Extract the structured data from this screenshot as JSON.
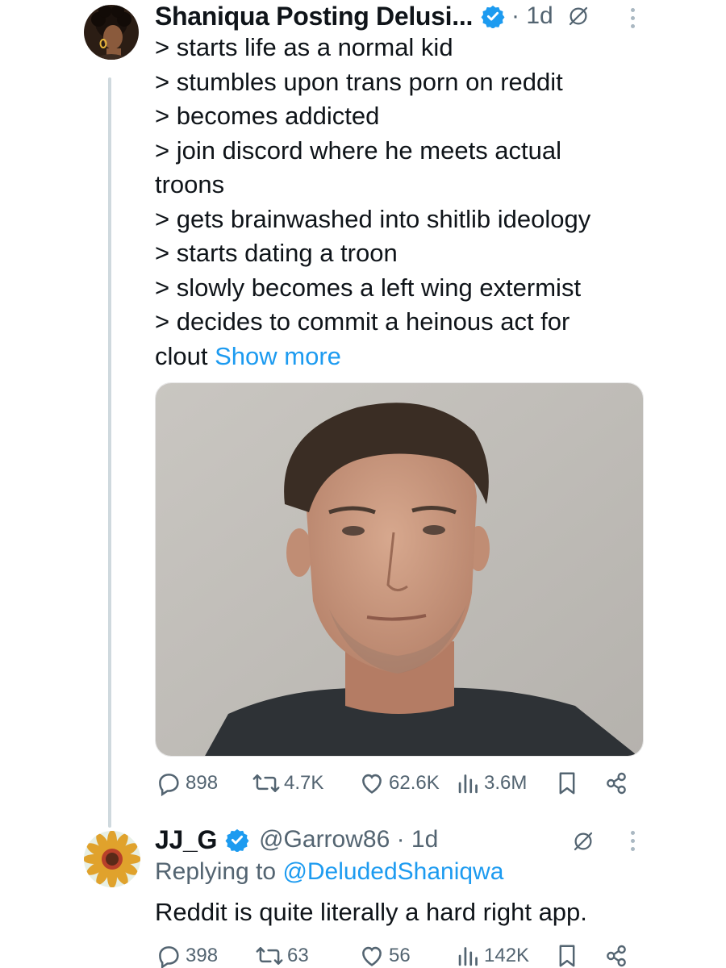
{
  "post1": {
    "display_name": "Shaniqua Posting Delusi...",
    "time": "· 1d",
    "lines": [
      "> starts life as a normal kid",
      "> stumbles upon trans porn on reddit",
      "> becomes addicted",
      "> join discord where he meets actual",
      "troons",
      "> gets brainwashed into shitlib ideology",
      "> starts dating a troon",
      "> slowly becomes a left wing extermist",
      "> decides to commit a heinous act for"
    ],
    "last_line_text": "clout",
    "show_more": "Show more",
    "stats": {
      "replies": "898",
      "reposts": "4.7K",
      "likes": "62.6K",
      "views": "3.6M"
    }
  },
  "post2": {
    "display_name": "JJ_G",
    "handle_time": "@Garrow86 · 1d",
    "replying_prefix": "Replying to",
    "replying_mention": "@DeludedShaniqwa",
    "text": "Reddit is quite literally a hard right app.",
    "stats": {
      "replies": "398",
      "reposts": "63",
      "likes": "56",
      "views": "142K"
    }
  },
  "colors": {
    "accent": "#1d9bf0",
    "muted": "#536471",
    "text": "#0f1419"
  },
  "icons": [
    "verified-badge-icon",
    "grok-icon",
    "more-icon",
    "reply-icon",
    "repost-icon",
    "like-icon",
    "views-icon",
    "bookmark-icon",
    "share-icon"
  ]
}
